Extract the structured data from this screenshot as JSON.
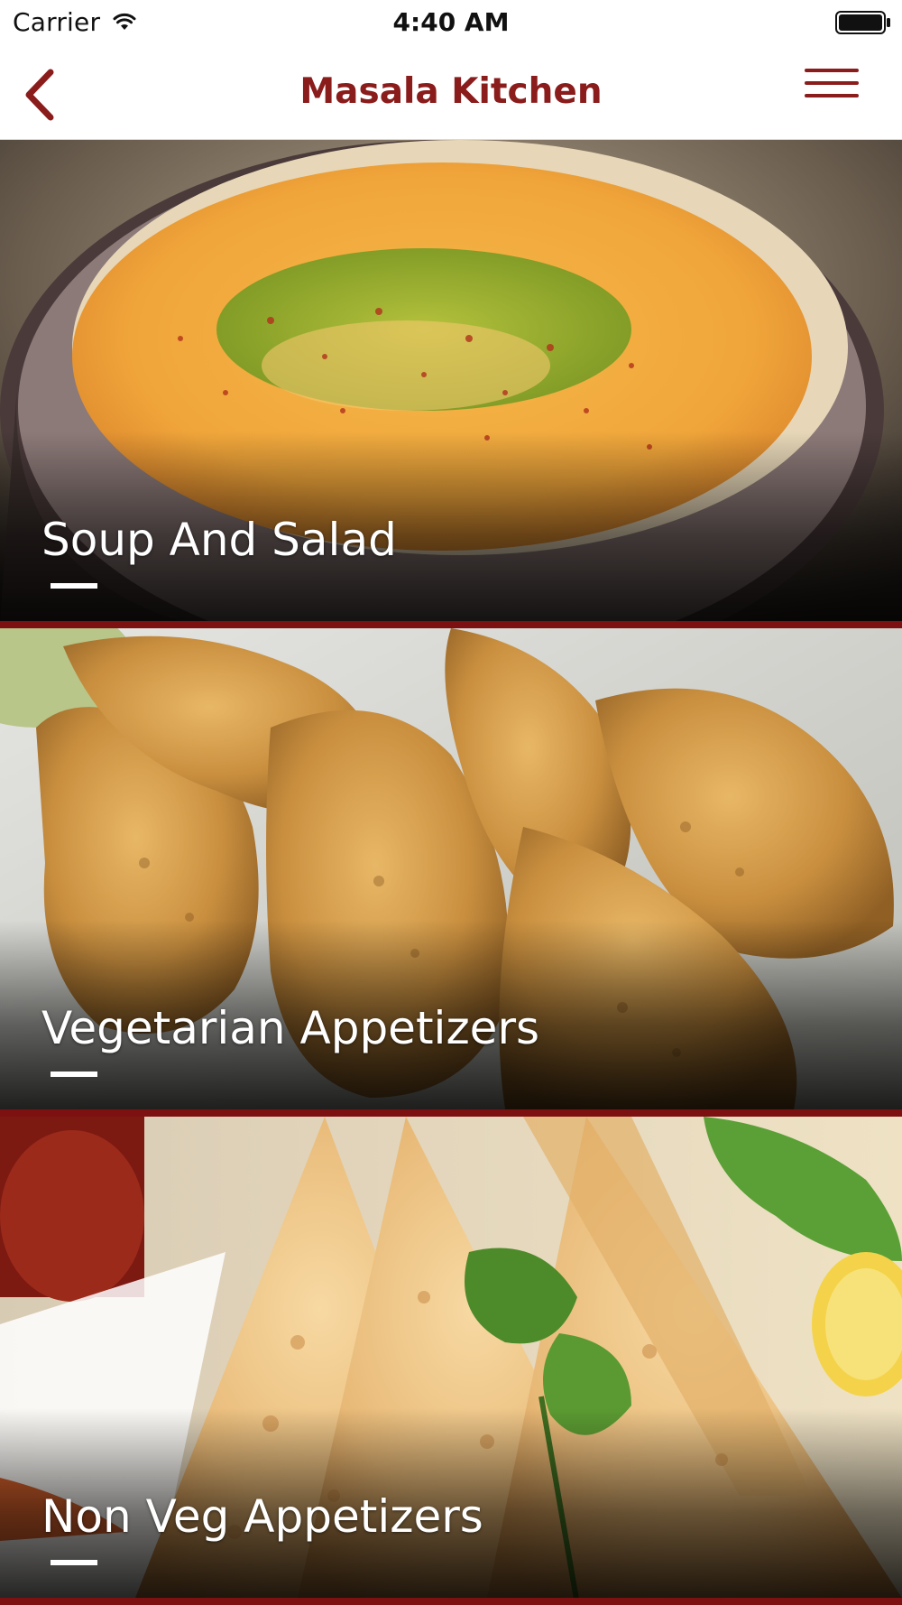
{
  "status_bar": {
    "carrier": "Carrier",
    "time": "4:40 AM",
    "wifi_icon": "wifi-icon",
    "battery_icon": "battery-icon"
  },
  "nav": {
    "title": "Masala Kitchen",
    "back_icon": "chevron-left-icon",
    "menu_icon": "hamburger-menu-icon",
    "accent_color": "#8a1c1c"
  },
  "categories": [
    {
      "title": "Soup And Salad",
      "photo": "soup-bowl-photo"
    },
    {
      "title": "Vegetarian Appetizers",
      "photo": "samosa-plate-photo"
    },
    {
      "title": "Non Veg Appetizers",
      "photo": "samosa-mint-photo"
    }
  ],
  "colors": {
    "divider": "#7d1111",
    "card_text": "#ffffff"
  }
}
